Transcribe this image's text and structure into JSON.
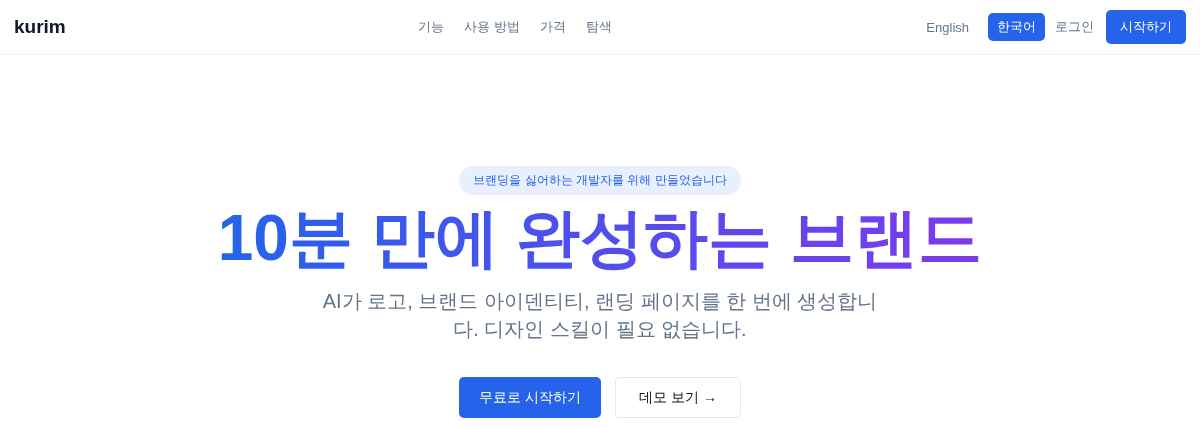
{
  "logo": "kurim",
  "nav": [
    {
      "label": "기능"
    },
    {
      "label": "사용 방법"
    },
    {
      "label": "가격"
    },
    {
      "label": "탐색"
    }
  ],
  "languages": [
    {
      "label": "English",
      "selected": false
    },
    {
      "label": "한국어",
      "selected": true
    }
  ],
  "login": "로그인",
  "start": "시작하기",
  "hero": {
    "badge": "브랜딩을 싫어하는 개발자를 위해 만들었습니다",
    "title": "10분 만에 완성하는 브랜드",
    "subtitle": "AI가 로고, 브랜드 아이덴티티, 랜딩 페이지를 한 번에 생성합니다. 디자인 스킬이 필요 없습니다.",
    "primary": "무료로 시작하기",
    "secondary": "데모 보기 →"
  }
}
